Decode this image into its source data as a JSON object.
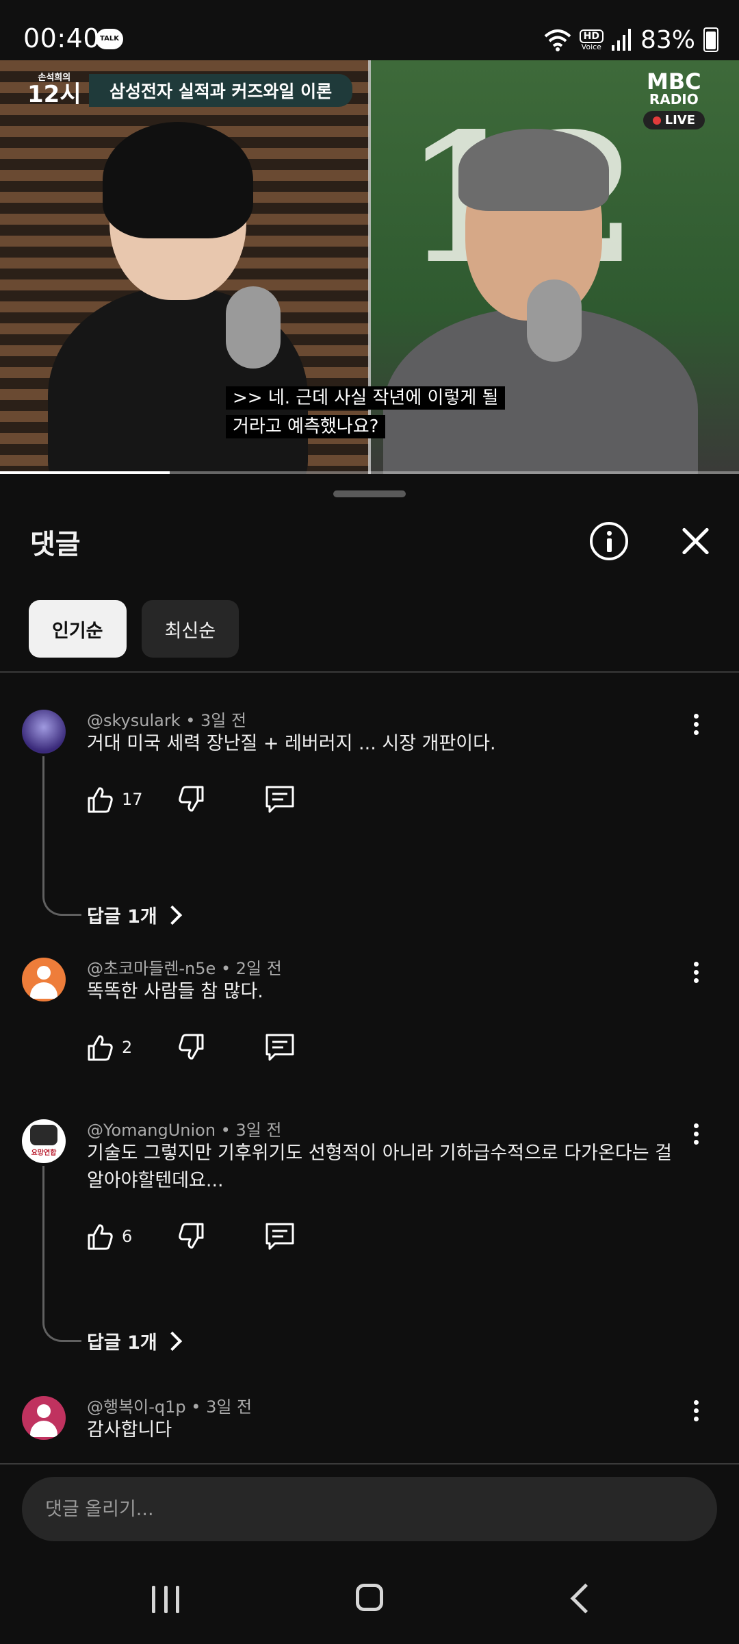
{
  "status_bar": {
    "time": "00:40",
    "talk_badge": "TALK",
    "hd_label": "HD",
    "voice_label": "Voice",
    "battery": "83%"
  },
  "video": {
    "show_small": "손석희의",
    "show_num": "12시",
    "topic": "삼성전자 실적과 커즈와일 이론",
    "station_line1": "MBC",
    "station_line2": "RADIO",
    "live_label": "LIVE",
    "caption": ">> 네. 근데 사실 작년에 이렇게 될 거라고 예측했나요?",
    "progress_fraction": 0.23
  },
  "comments_panel": {
    "title": "댓글",
    "chips": [
      {
        "label": "인기순",
        "active": true
      },
      {
        "label": "최신순",
        "active": false
      }
    ],
    "comments": [
      {
        "author": "@skysulark",
        "time": "3일 전",
        "text": "거대 미국 세력 장난질 + 레버러지 ... 시장 개판이다.",
        "likes": "17",
        "replies": "답글 1개"
      },
      {
        "author": "@초코마들렌-n5e",
        "time": "2일 전",
        "text": "똑똑한 사람들 참 많다.",
        "likes": "2",
        "replies": ""
      },
      {
        "author": "@YomangUnion",
        "time": "3일 전",
        "text": "기술도 그렇지만 기후위기도 선형적이 아니라 기하급수적으로 다가온다는 걸 알아야할텐데요...",
        "likes": "6",
        "replies": "답글 1개",
        "avatar_text": "요망연합"
      },
      {
        "author": "@행복이-q1p",
        "time": "3일 전",
        "text": "감사합니다",
        "likes": "",
        "replies": ""
      }
    ],
    "input_placeholder": "댓글 올리기..."
  },
  "icons": {
    "info": "info-icon",
    "close": "close-icon",
    "like": "thumbs-up-icon",
    "dislike": "thumbs-down-icon",
    "reply": "comment-icon",
    "more": "kebab-menu-icon"
  }
}
